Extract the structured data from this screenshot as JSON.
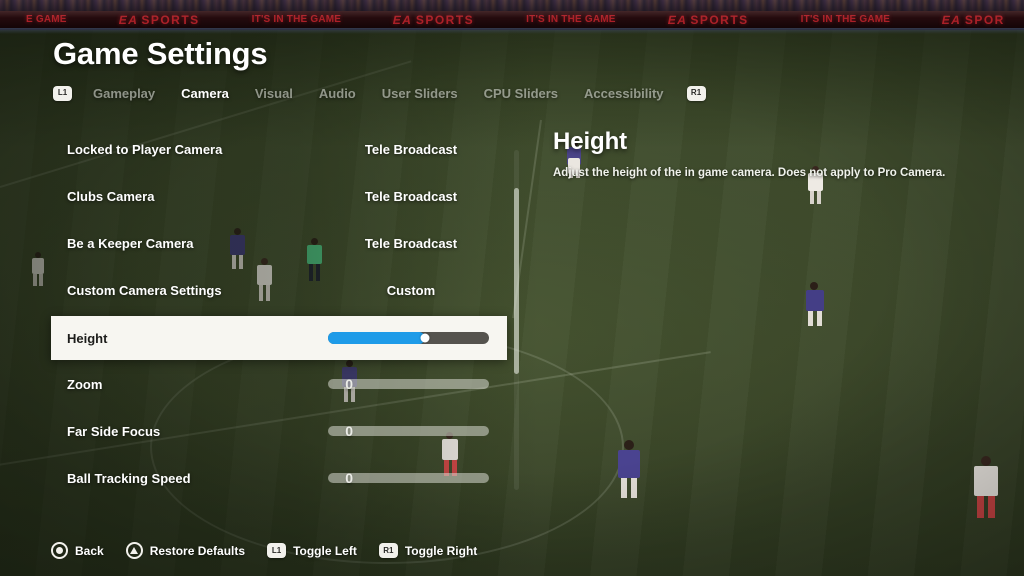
{
  "header": {
    "title": "Game Settings"
  },
  "banner": {
    "segments": [
      {
        "type": "itg",
        "text": "E GAME"
      },
      {
        "type": "ea",
        "text": "SPORTS"
      },
      {
        "type": "itg",
        "text": "IT'S IN THE GAME"
      },
      {
        "type": "ea",
        "text": "SPORTS"
      },
      {
        "type": "itg",
        "text": "IT'S IN THE GAME"
      },
      {
        "type": "ea",
        "text": "SPORTS"
      },
      {
        "type": "itg",
        "text": "IT'S IN THE GAME"
      },
      {
        "type": "ea",
        "text": "SPOR"
      }
    ],
    "ea_mark": "EA"
  },
  "tabs": {
    "left_bumper": "L1",
    "right_bumper": "R1",
    "items": [
      {
        "label": "Gameplay",
        "active": false
      },
      {
        "label": "Camera",
        "active": true
      },
      {
        "label": "Visual",
        "active": false
      },
      {
        "label": "Audio",
        "active": false
      },
      {
        "label": "User Sliders",
        "active": false
      },
      {
        "label": "CPU Sliders",
        "active": false
      },
      {
        "label": "Accessibility",
        "active": false
      }
    ]
  },
  "settings": {
    "rows": [
      {
        "label": "Locked to Player Camera",
        "value_text": "Tele Broadcast",
        "kind": "option",
        "selected": false
      },
      {
        "label": "Clubs Camera",
        "value_text": "Tele Broadcast",
        "kind": "option",
        "selected": false
      },
      {
        "label": "Be a Keeper Camera",
        "value_text": "Tele Broadcast",
        "kind": "option",
        "selected": false
      },
      {
        "label": "Custom Camera Settings",
        "value_text": "Custom",
        "kind": "option",
        "selected": false
      },
      {
        "label": "Height",
        "value_num": "12",
        "kind": "slider",
        "selected": true,
        "fill_percent": 60
      },
      {
        "label": "Zoom",
        "value_num": "0",
        "kind": "slider",
        "selected": false,
        "fill_percent": 0
      },
      {
        "label": "Far Side Focus",
        "value_num": "0",
        "kind": "slider",
        "selected": false,
        "fill_percent": 0
      },
      {
        "label": "Ball Tracking Speed",
        "value_num": "0",
        "kind": "slider",
        "selected": false,
        "fill_percent": 0
      }
    ]
  },
  "detail": {
    "title": "Height",
    "description": "Adjust the height of the in game camera. Does not apply to Pro Camera."
  },
  "actions": [
    {
      "label": "Back",
      "icon": "circle-button-icon"
    },
    {
      "label": "Restore Defaults",
      "icon": "triangle-button-icon"
    },
    {
      "label": "Toggle Left",
      "icon": "l1-bumper-icon",
      "badge": "L1"
    },
    {
      "label": "Toggle Right",
      "icon": "r1-bumper-icon",
      "badge": "R1"
    }
  ],
  "colors": {
    "accent_blue": "#1e9be8",
    "selected_row_bg": "#f7f6f1",
    "pitch_green": "#3c4a2b",
    "led_red": "#b8232b"
  }
}
